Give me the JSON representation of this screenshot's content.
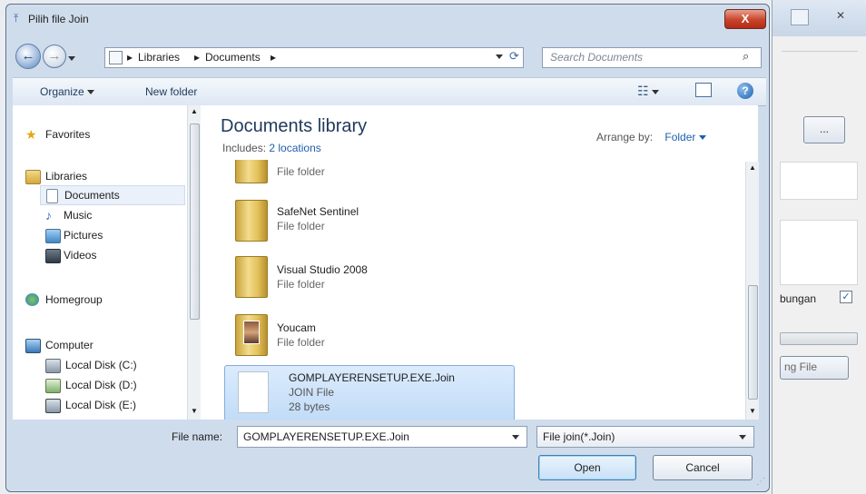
{
  "dialog": {
    "title": "Pilih file Join",
    "close_label": "X"
  },
  "nav": {
    "breadcrumb": [
      "Libraries",
      "Documents"
    ],
    "search_placeholder": "Search Documents"
  },
  "toolbar": {
    "organize_label": "Organize",
    "new_folder_label": "New folder"
  },
  "sidebar": {
    "favorites": "Favorites",
    "libraries": "Libraries",
    "documents": "Documents",
    "music": "Music",
    "pictures": "Pictures",
    "videos": "Videos",
    "homegroup": "Homegroup",
    "computer": "Computer",
    "disk_c": "Local Disk (C:)",
    "disk_d": "Local Disk (D:)",
    "disk_e": "Local Disk (E:)"
  },
  "library": {
    "title": "Documents library",
    "includes_label": "Includes:",
    "includes_link": "2 locations",
    "arrange_label": "Arrange by:",
    "arrange_value": "Folder"
  },
  "files": [
    {
      "name": "",
      "type": "File folder"
    },
    {
      "name": "SafeNet Sentinel",
      "type": "File folder"
    },
    {
      "name": "Visual Studio 2008",
      "type": "File folder"
    },
    {
      "name": "Youcam",
      "type": "File folder"
    },
    {
      "name": "GOMPLAYERENSETUP.EXE.Join",
      "type": "JOIN File",
      "size": "28 bytes"
    }
  ],
  "footer": {
    "filename_label": "File name:",
    "filename_value": "GOMPLAYERENSETUP.EXE.Join",
    "filter_value": "File join(*.Join)",
    "open_label": "Open",
    "cancel_label": "Cancel"
  },
  "background_window": {
    "browse_label": "...",
    "checkbox_label": "bungan",
    "button_label": "ng File"
  }
}
